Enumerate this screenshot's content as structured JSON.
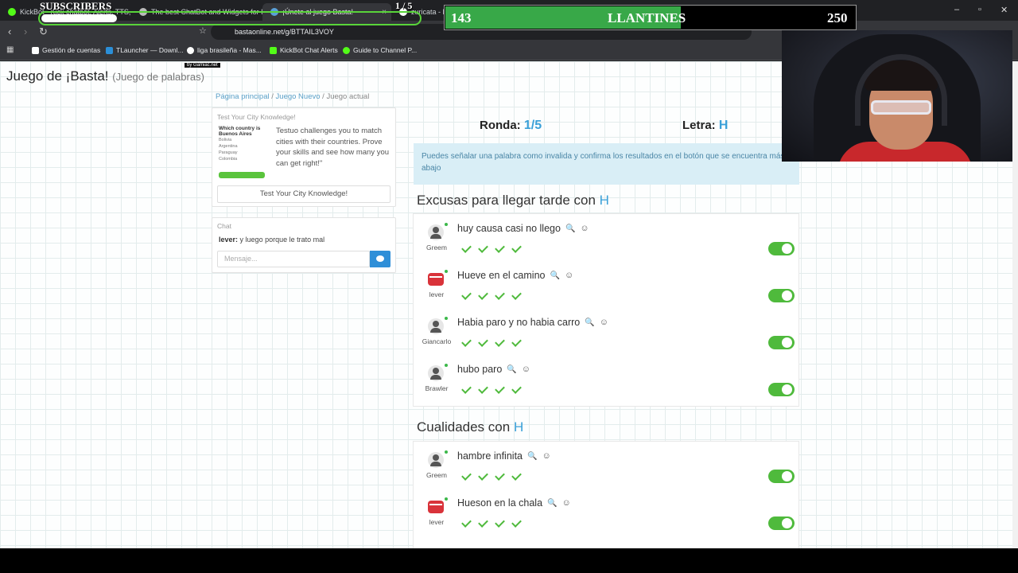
{
  "browser": {
    "tabs": [
      {
        "label": "KickBot - Kick chatbot, Alerts, TTS, Gi...",
        "color": "#53fc18"
      },
      {
        "label": "The best ChatBot and Widgets for Kick...",
        "color": "#bbbbbb"
      },
      {
        "label": "¡Únete al juego Basta!",
        "color": "#5aa0d8"
      },
      {
        "label": "zuricata - M...",
        "color": "#ffffff"
      }
    ],
    "close_glyph": "×",
    "url": "bastaonline.net/g/BTTAIL3VOY",
    "bookmarks": [
      {
        "label": "Gestión de cuentas",
        "color": "#ffffff"
      },
      {
        "label": "TLauncher — Downl...",
        "color": "#2b8fd8"
      },
      {
        "label": "liga brasileña - Mas...",
        "color": "#ffffff"
      },
      {
        "label": "KickBot Chat Alerts",
        "color": "#53fc18"
      },
      {
        "label": "Guide to Channel P...",
        "color": "#53fc18"
      }
    ]
  },
  "overlay": {
    "subscribers_label": "SUBSCRIBERS",
    "subscribers_count": "1 / 5",
    "subscribers_progress": 0.2,
    "goal_left": "143",
    "goal_title": "LLANTINES",
    "goal_right": "250",
    "goal_progress": 0.572
  },
  "page": {
    "title": "Juego de ¡Basta!",
    "subtitle": "(Juego de palabras)",
    "watermark": "by Gamiac.net",
    "breadcrumb": [
      "Página principal",
      "Juego Nuevo",
      "Juego actual"
    ],
    "breadcrumb_sep": "/",
    "ad": {
      "title": "Test Your City Knowledge!",
      "thumb_question": "Which country is Buenos Aires",
      "thumb_options": [
        "Bolivia",
        "Argentina",
        "Paraguay",
        "Colombia"
      ],
      "text": "Testuo challenges you to match cities with their countries. Prove your skills and see how many you can get right!\"",
      "button": "Test Your City Knowledge!"
    },
    "chat": {
      "title": "Chat",
      "message_user": "lever:",
      "message_text": "y luego porque le trato mal",
      "input_placeholder": "Mensaje..."
    },
    "round_label": "Ronda:",
    "round_value": "1/5",
    "letter_label": "Letra:",
    "letter_value": "H",
    "alert": "Puedes señalar una palabra como invalida y confirma los resultados en el botón que se encuentra más abajo",
    "categories": [
      {
        "title": "Excusas para llegar tarde con",
        "letter": "H",
        "answers": [
          {
            "word": "huy causa casi no llego",
            "player": "Greem",
            "avatar": "person"
          },
          {
            "word": "Hueve en el camino",
            "player": "lever",
            "avatar": "stop"
          },
          {
            "word": "Habia paro y no habia carro",
            "player": "Giancarlo",
            "avatar": "person"
          },
          {
            "word": "hubo paro",
            "player": "Brawler",
            "avatar": "person"
          }
        ]
      },
      {
        "title": "Cualidades con",
        "letter": "H",
        "answers": [
          {
            "word": "hambre infinita",
            "player": "Greem",
            "avatar": "person"
          },
          {
            "word": "Hueson en la chala",
            "player": "lever",
            "avatar": "stop"
          }
        ]
      }
    ],
    "icons": {
      "search": "🔍",
      "smile": "☺"
    }
  }
}
